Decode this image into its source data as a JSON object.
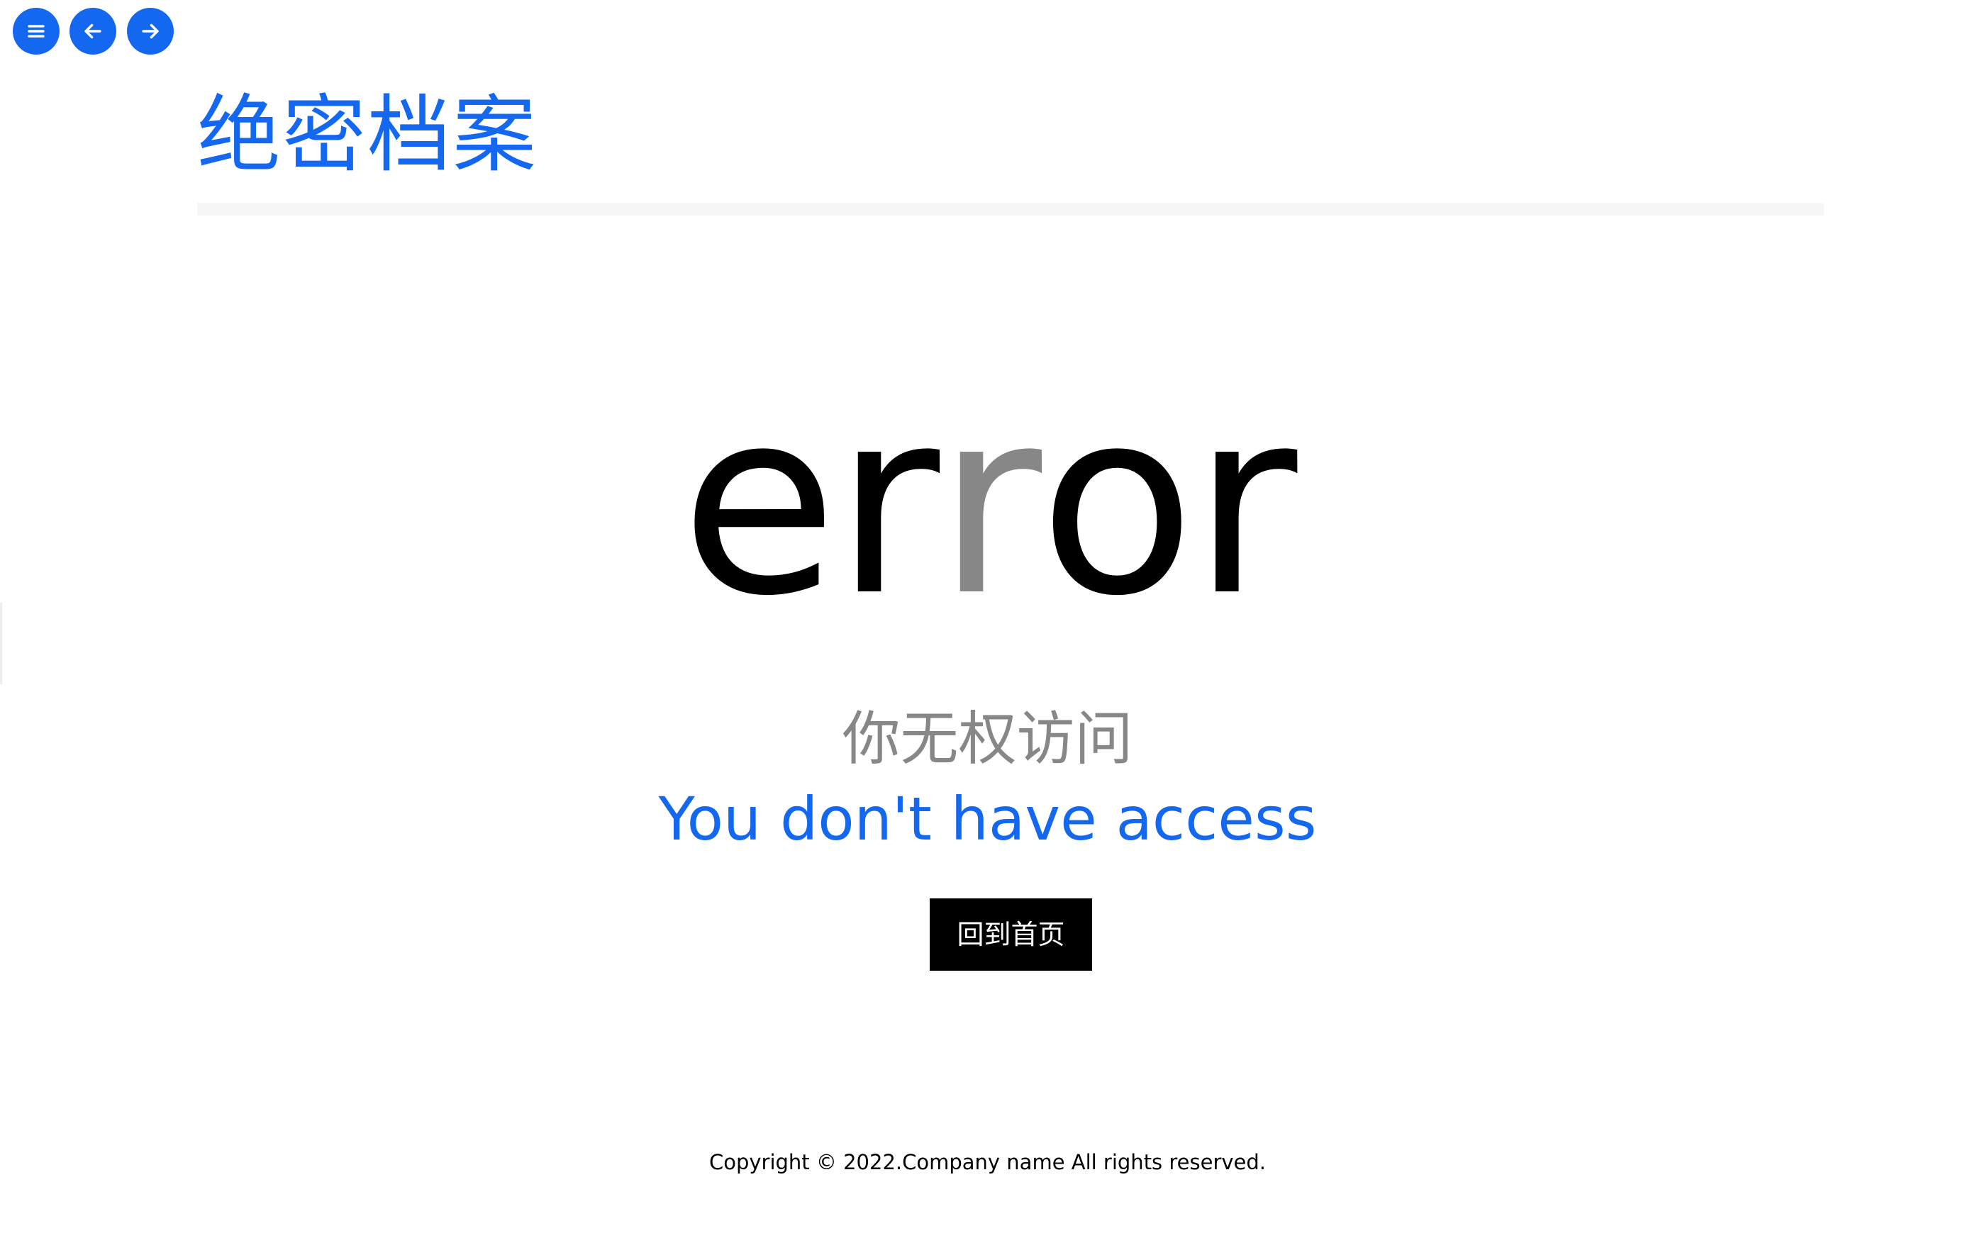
{
  "toolbar": {
    "buttons": [
      {
        "icon": "menu-icon"
      },
      {
        "icon": "arrow-left-icon"
      },
      {
        "icon": "arrow-right-icon"
      }
    ],
    "accent_color": "#1468f0"
  },
  "header": {
    "title": "绝密档案"
  },
  "error": {
    "letters": [
      "e",
      "r",
      "r",
      "o",
      "r"
    ],
    "highlight_index": 2,
    "highlight_color": "#878787",
    "message_zh": "你无权访问",
    "message_en": "You don't have access",
    "home_button_label": "回到首页"
  },
  "footer": {
    "copyright": "Copyright © 2022.Company name All rights reserved."
  }
}
